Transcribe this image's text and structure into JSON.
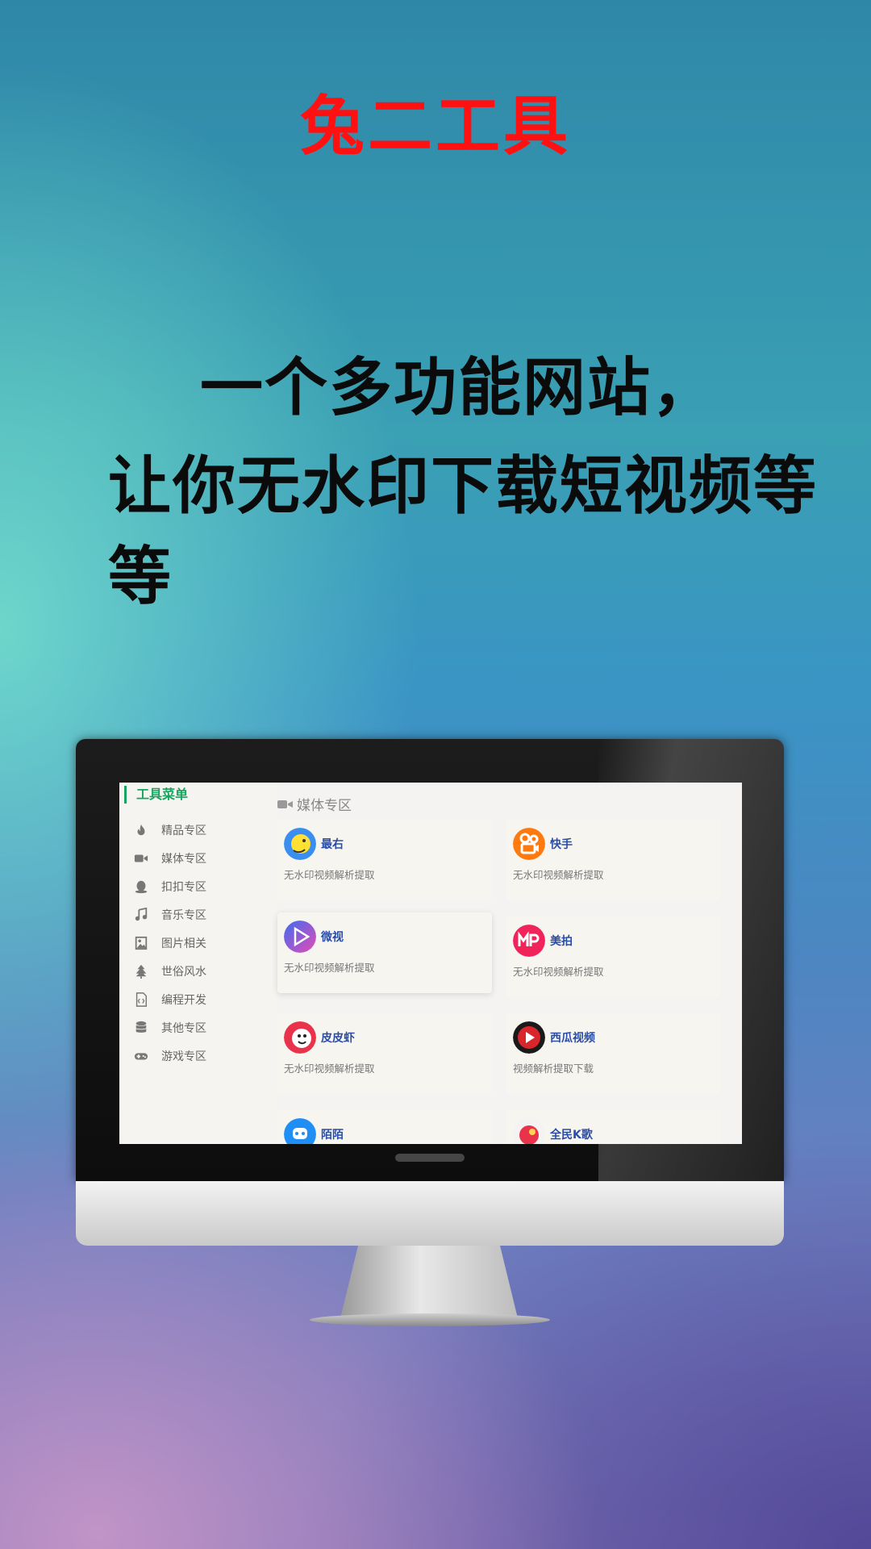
{
  "app_title": "兔二工具",
  "slogan": [
    "一个多功能网站，",
    "让你无水印下载短视频等等"
  ],
  "sidebar": {
    "title": "工具菜单",
    "items": [
      {
        "label": "精品专区",
        "icon": "fire-icon"
      },
      {
        "label": "媒体专区",
        "icon": "video-camera-icon"
      },
      {
        "label": "扣扣专区",
        "icon": "penguin-icon"
      },
      {
        "label": "音乐专区",
        "icon": "music-note-icon"
      },
      {
        "label": "图片相关",
        "icon": "image-icon"
      },
      {
        "label": "世俗风水",
        "icon": "tree-icon"
      },
      {
        "label": "编程开发",
        "icon": "code-file-icon"
      },
      {
        "label": "其他专区",
        "icon": "database-icon"
      },
      {
        "label": "游戏专区",
        "icon": "gamepad-icon"
      }
    ]
  },
  "main": {
    "section_title": "媒体专区",
    "cards": [
      {
        "name": "最右",
        "desc": "无水印视频解析提取",
        "icon": "zuiyou-logo-icon",
        "color": "#3a8ef0"
      },
      {
        "name": "快手",
        "desc": "无水印视频解析提取",
        "icon": "kuaishou-logo-icon",
        "color": "#ff7a0e"
      },
      {
        "name": "微视",
        "desc": "无水印视频解析提取",
        "icon": "weishi-logo-icon",
        "color": "#7b5cf0"
      },
      {
        "name": "美拍",
        "desc": "无水印视频解析提取",
        "icon": "meipai-logo-icon",
        "color": "#f0245a"
      },
      {
        "name": "皮皮虾",
        "desc": "无水印视频解析提取",
        "icon": "pipixia-logo-icon",
        "color": "#e8334a"
      },
      {
        "name": "西瓜视频",
        "desc": "视频解析提取下载",
        "icon": "xigua-logo-icon",
        "color": "#d9262c"
      },
      {
        "name": "陌陌",
        "desc": "",
        "icon": "momo-logo-icon",
        "color": "#1f8ff5"
      },
      {
        "name": "全民K歌",
        "desc": "",
        "icon": "quanminkge-logo-icon",
        "color": "#e8334a"
      }
    ]
  }
}
